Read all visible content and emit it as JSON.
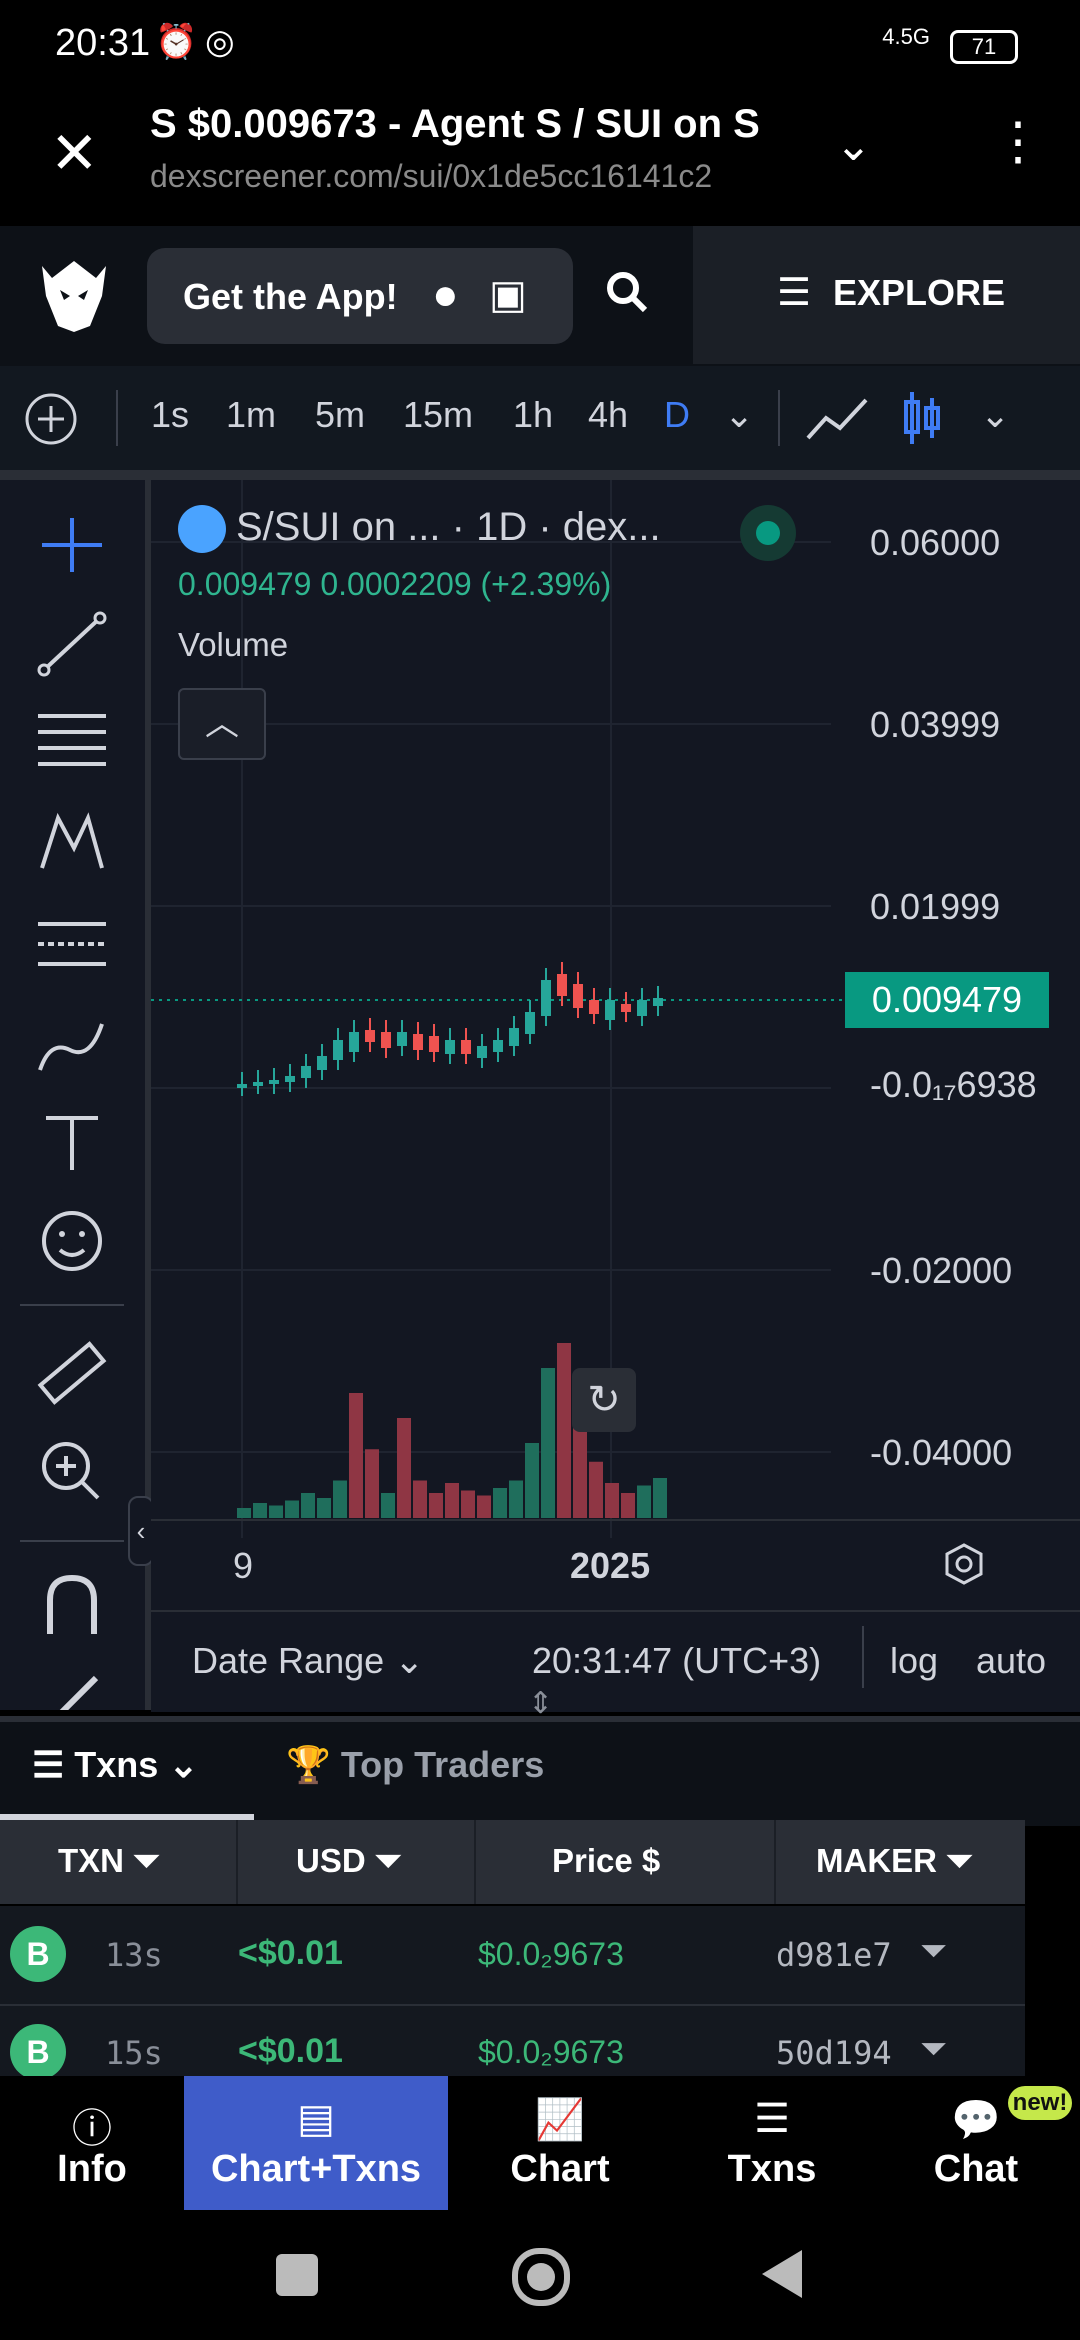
{
  "status": {
    "time": "20:31",
    "network": "4.5G",
    "battery": "71"
  },
  "browser": {
    "title": "S $0.009673 - Agent S / SUI on S",
    "url": "dexscreener.com/sui/0x1de5cc16141c2"
  },
  "header": {
    "get_app": "Get the App!",
    "explore": "EXPLORE"
  },
  "timeframes": [
    "1s",
    "1m",
    "5m",
    "15m",
    "1h",
    "4h",
    "D"
  ],
  "chart": {
    "legend_title": "S/SUI on ... · 1D · dex...",
    "legend_values": "0.009479  0.0002209 (+2.39%)",
    "volume_label": "Volume",
    "price_axis": [
      "0.06000",
      "0.03999",
      "0.01999",
      "-0.0₁₇6938",
      "-0.02000",
      "-0.04000"
    ],
    "current_price": "0.009479",
    "x_labels": [
      "9",
      "2025"
    ],
    "date_range": "Date Range",
    "clock": "20:31:47 (UTC+3)",
    "log": "log",
    "auto": "auto"
  },
  "chart_data": {
    "type": "bar",
    "series": [
      {
        "name": "Volume",
        "values": [
          8,
          12,
          10,
          14,
          20,
          16,
          30,
          100,
          55,
          20,
          80,
          30,
          20,
          28,
          22,
          18,
          24,
          30,
          60,
          120,
          140,
          75,
          45,
          28,
          20,
          26,
          32
        ]
      }
    ]
  },
  "tabs": {
    "txns": "Txns",
    "top_traders": "Top Traders"
  },
  "table": {
    "headers": [
      "TXN",
      "USD",
      "Price",
      "MAKER"
    ],
    "rows": [
      {
        "type": "B",
        "age": "13s",
        "usd": "<$0.01",
        "price": "$0.0₂9673",
        "maker": "d981e7"
      },
      {
        "type": "B",
        "age": "15s",
        "usd": "<$0.01",
        "price": "$0.0₂9673",
        "maker": "50d194"
      }
    ]
  },
  "nav": [
    {
      "label": "Info"
    },
    {
      "label": "Chart+Txns"
    },
    {
      "label": "Chart"
    },
    {
      "label": "Txns"
    },
    {
      "label": "Chat",
      "badge": "new!"
    }
  ]
}
